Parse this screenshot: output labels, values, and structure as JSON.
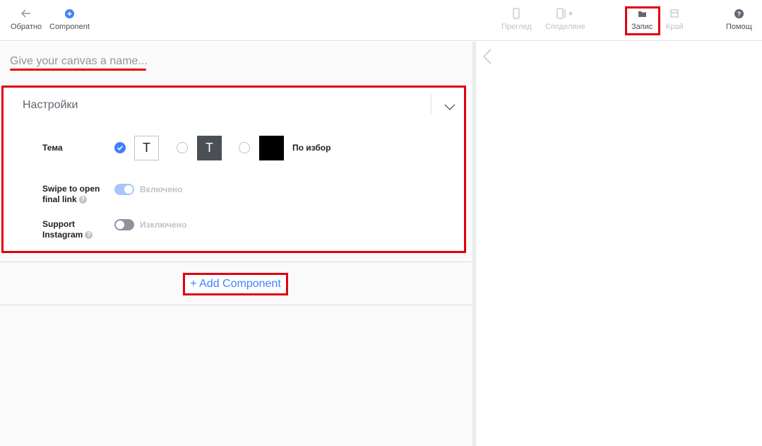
{
  "toolbar": {
    "back_label": "Обратно",
    "component_label": "Component",
    "preview_label": "Преглед",
    "share_label": "Споделяне",
    "save_label": "Запис",
    "finish_label": "Край",
    "help_label": "Помощ"
  },
  "canvas": {
    "name_placeholder": "Give your canvas a name..."
  },
  "settings": {
    "title": "Настройки",
    "theme_label": "Тема",
    "theme_options": [
      "T",
      "T"
    ],
    "theme_custom_label": "По избор",
    "swipe_label_1": "Swipe to open",
    "swipe_label_2": "final link",
    "swipe_state": "Включено",
    "instagram_label_1": "Support",
    "instagram_label_2": "Instagram",
    "instagram_state": "Изключено",
    "help_glyph": "?"
  },
  "add_component_label": "+ Add Component",
  "colors": {
    "accent": "#4080ff",
    "highlight": "#e0000f",
    "dark_theme": "#4b4f56",
    "custom_theme": "#000000"
  }
}
